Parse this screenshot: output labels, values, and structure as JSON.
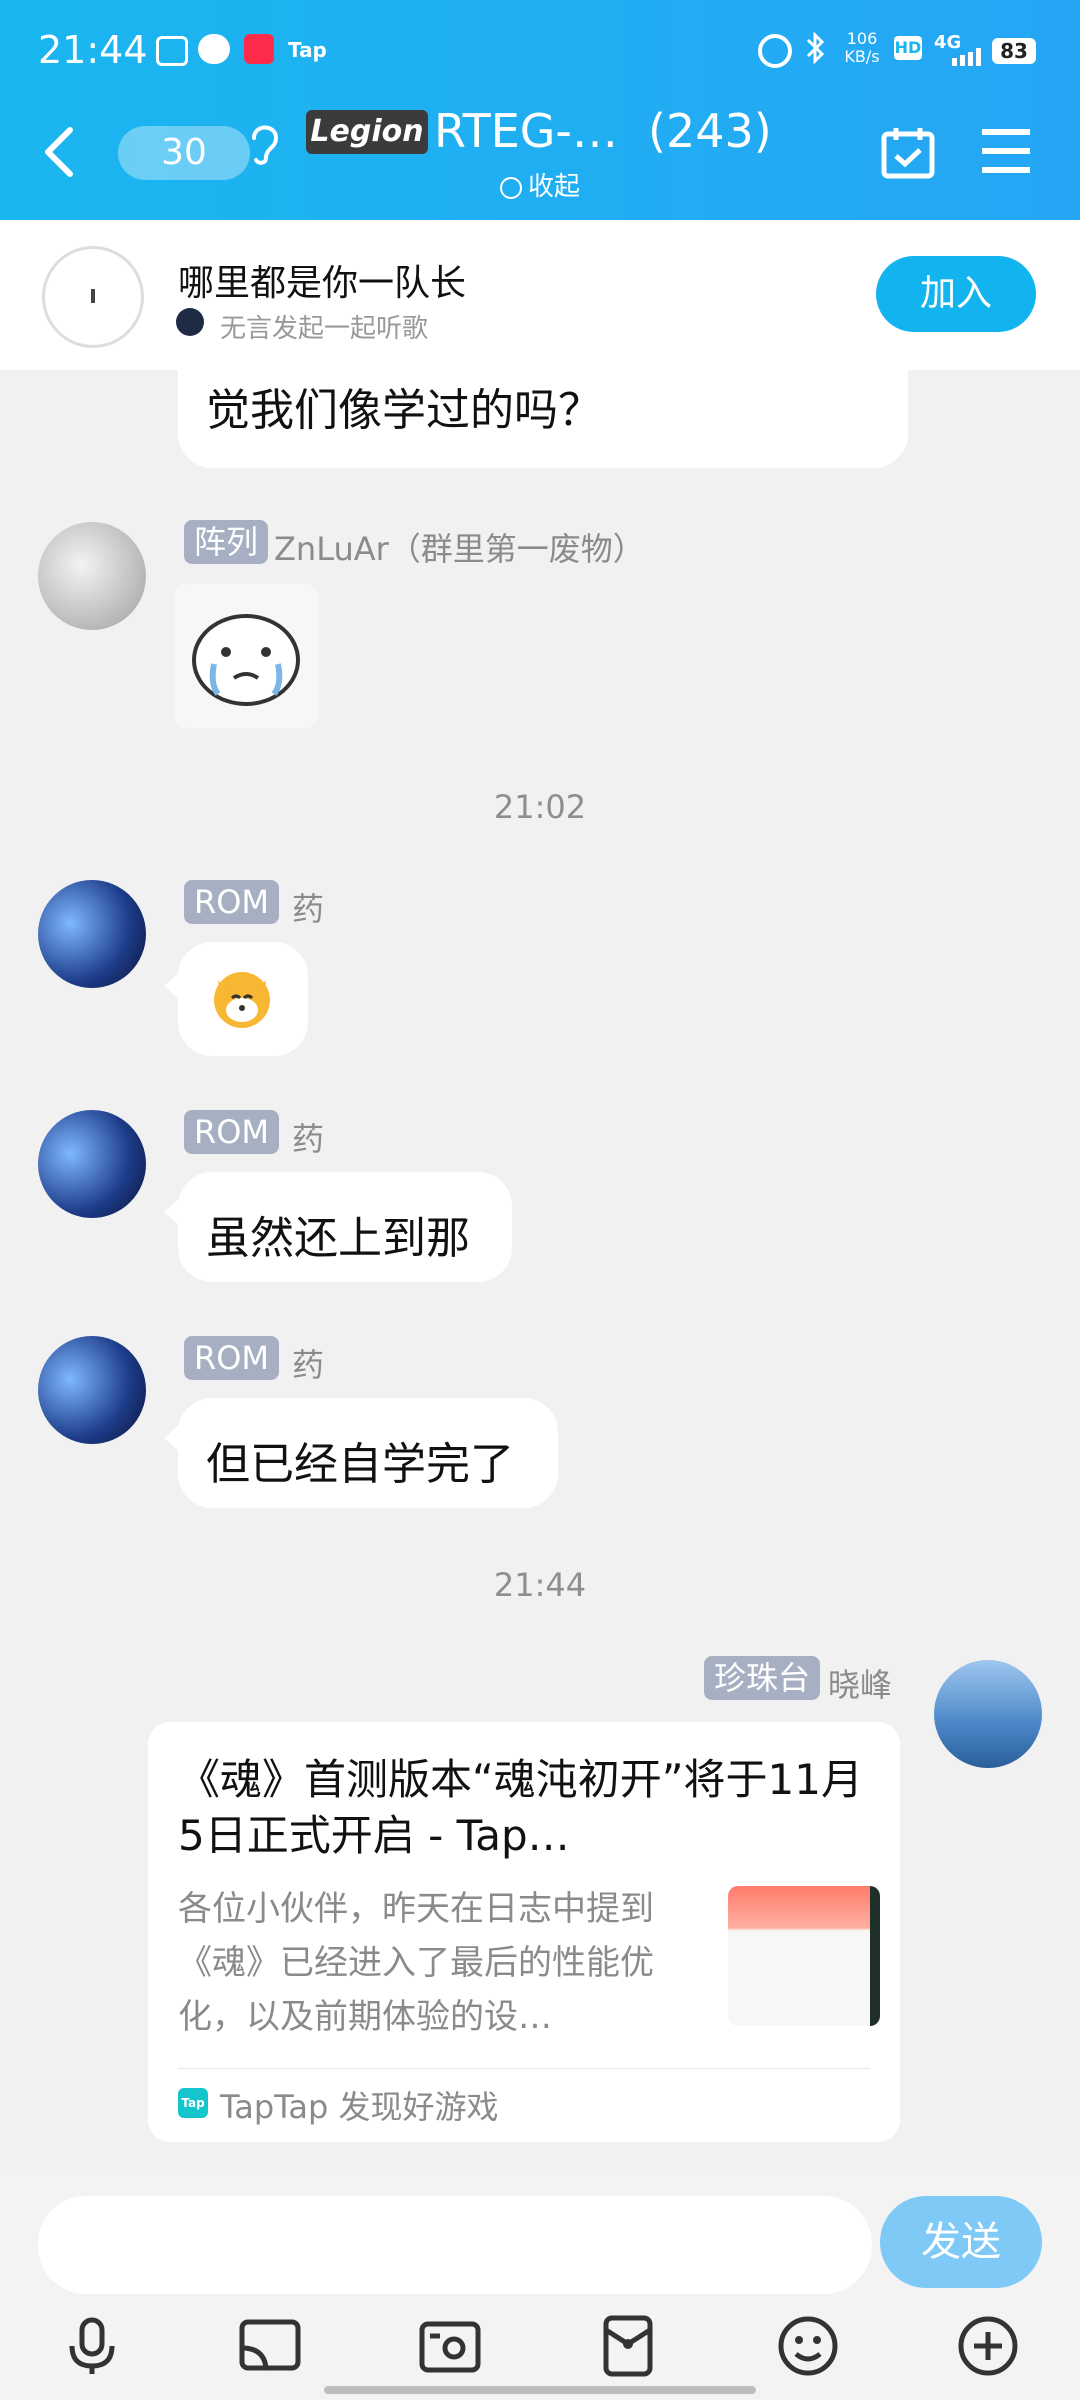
{
  "status_bar": {
    "time": "21:44",
    "app_icons": [
      "bilibili-icon",
      "chat-bot-icon",
      "xiaohongshu-icon",
      "taptap-icon"
    ],
    "net_speed": "106",
    "net_speed_unit": "KB/s",
    "hd": "HD",
    "network": "4G",
    "battery": "83"
  },
  "header": {
    "back_icon": "chevron-left-icon",
    "unread_count": "30",
    "earpiece_icon": "ear-icon",
    "group_logo_text": "Legion",
    "title": "RTEG-…",
    "member_count": "(243)",
    "collapse_label": "收起",
    "calendar_icon": "calendar-check-icon",
    "menu_icon": "menu-icon"
  },
  "listen_banner": {
    "title": "哪里都是你一队长",
    "subtitle": "无言发起一起听歌",
    "join_label": "加入"
  },
  "messages": {
    "m0": {
      "text": "觉我们像学过的吗？"
    },
    "m1": {
      "tag": "阵列",
      "name": "ZnLuAr（群里第一废物）"
    },
    "time1": "21:02",
    "m2": {
      "tag": "ROM",
      "name": "药"
    },
    "m3": {
      "tag": "ROM",
      "name": "药",
      "text": "虽然还上到那"
    },
    "m4": {
      "tag": "ROM",
      "name": "药",
      "text": "但已经自学完了"
    },
    "time2": "21:44",
    "m5": {
      "tag": "珍珠台",
      "name": "晓峰",
      "card_title": "《魂》首测版本“魂沌初开”将于11月5日正式开启 - Tap…",
      "card_desc": "各位小伙伴，昨天在日志中提到《魂》已经进入了最后的性能优化，以及前期体验的设…",
      "card_source": "TapTap 发现好游戏",
      "source_badge": "Tap"
    }
  },
  "input": {
    "placeholder": "",
    "send_label": "发送"
  },
  "toolbar": {
    "icons": [
      "microphone-icon",
      "screen-cast-icon",
      "camera-icon",
      "red-packet-icon",
      "emoji-icon",
      "plus-icon"
    ]
  },
  "colors": {
    "header": "#1ab6ef",
    "join": "#12b4ef",
    "send": "#7ec9f5",
    "tag": "#a7b0c3"
  }
}
